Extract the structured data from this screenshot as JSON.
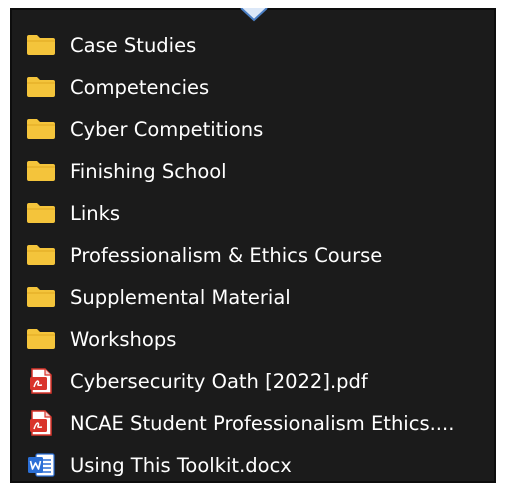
{
  "explorer": {
    "items": [
      {
        "label": "Case Studies",
        "icon": "folder-icon"
      },
      {
        "label": "Competencies",
        "icon": "folder-icon"
      },
      {
        "label": "Cyber Competitions",
        "icon": "folder-icon"
      },
      {
        "label": "Finishing School",
        "icon": "folder-icon"
      },
      {
        "label": "Links",
        "icon": "folder-icon"
      },
      {
        "label": "Professionalism & Ethics Course",
        "icon": "folder-icon"
      },
      {
        "label": "Supplemental Material",
        "icon": "folder-icon"
      },
      {
        "label": "Workshops",
        "icon": "folder-icon"
      },
      {
        "label": "Cybersecurity Oath [2022].pdf",
        "icon": "pdf-file-icon"
      },
      {
        "label": "NCAE Student Professionalism Ethics....",
        "icon": "pdf-file-icon"
      },
      {
        "label": "Using This Toolkit.docx",
        "icon": "word-file-icon"
      }
    ],
    "colors": {
      "background": "#1b1b1b",
      "text": "#ffffff",
      "folder": "#f4c43b",
      "pdf": "#d9342b",
      "word": "#2b6fd6",
      "pointer": "#4b7fc4"
    }
  }
}
